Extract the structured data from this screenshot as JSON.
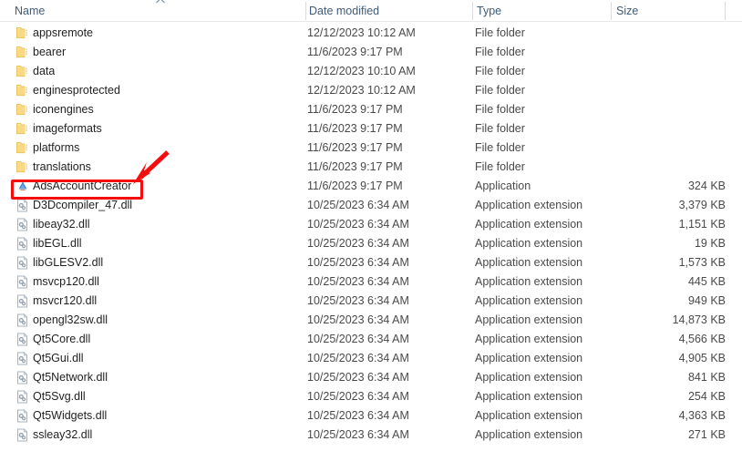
{
  "window": {
    "app": "windows-file-explorer",
    "view_mode": "details"
  },
  "columns": [
    {
      "key": "name",
      "label": "Name",
      "sorted": true,
      "sort_direction": "ascending"
    },
    {
      "key": "date",
      "label": "Date modified",
      "sorted": false,
      "sort_direction": ""
    },
    {
      "key": "type",
      "label": "Type",
      "sorted": false,
      "sort_direction": ""
    },
    {
      "key": "size",
      "label": "Size",
      "sorted": false,
      "sort_direction": ""
    }
  ],
  "colors": {
    "header_text": "#3f5b78",
    "row_text": "#1f1f1f",
    "meta_text": "#4a4a4a",
    "annotation": "#f50d0d",
    "folder_icon": "#f7d272",
    "dll_icon": "#b9c3cc"
  },
  "rows": [
    {
      "name": "appsremote",
      "date": "12/12/2023 10:12 AM",
      "type": "File folder",
      "size": "",
      "icon": "folder-icon"
    },
    {
      "name": "bearer",
      "date": "11/6/2023 9:17 PM",
      "type": "File folder",
      "size": "",
      "icon": "folder-icon"
    },
    {
      "name": "data",
      "date": "12/12/2023 10:10 AM",
      "type": "File folder",
      "size": "",
      "icon": "folder-icon"
    },
    {
      "name": "enginesprotected",
      "date": "12/12/2023 10:12 AM",
      "type": "File folder",
      "size": "",
      "icon": "folder-icon"
    },
    {
      "name": "iconengines",
      "date": "11/6/2023 9:17 PM",
      "type": "File folder",
      "size": "",
      "icon": "folder-icon"
    },
    {
      "name": "imageformats",
      "date": "11/6/2023 9:17 PM",
      "type": "File folder",
      "size": "",
      "icon": "folder-icon"
    },
    {
      "name": "platforms",
      "date": "11/6/2023 9:17 PM",
      "type": "File folder",
      "size": "",
      "icon": "folder-icon"
    },
    {
      "name": "translations",
      "date": "11/6/2023 9:17 PM",
      "type": "File folder",
      "size": "",
      "icon": "folder-icon"
    },
    {
      "name": "AdsAccountCreator",
      "date": "11/6/2023 9:17 PM",
      "type": "Application",
      "size": "324 KB",
      "icon": "application-icon",
      "highlighted": true
    },
    {
      "name": "D3Dcompiler_47.dll",
      "date": "10/25/2023 6:34 AM",
      "type": "Application extension",
      "size": "3,379 KB",
      "icon": "dll-icon"
    },
    {
      "name": "libeay32.dll",
      "date": "10/25/2023 6:34 AM",
      "type": "Application extension",
      "size": "1,151 KB",
      "icon": "dll-icon"
    },
    {
      "name": "libEGL.dll",
      "date": "10/25/2023 6:34 AM",
      "type": "Application extension",
      "size": "19 KB",
      "icon": "dll-icon"
    },
    {
      "name": "libGLESV2.dll",
      "date": "10/25/2023 6:34 AM",
      "type": "Application extension",
      "size": "1,573 KB",
      "icon": "dll-icon"
    },
    {
      "name": "msvcp120.dll",
      "date": "10/25/2023 6:34 AM",
      "type": "Application extension",
      "size": "445 KB",
      "icon": "dll-icon"
    },
    {
      "name": "msvcr120.dll",
      "date": "10/25/2023 6:34 AM",
      "type": "Application extension",
      "size": "949 KB",
      "icon": "dll-icon"
    },
    {
      "name": "opengl32sw.dll",
      "date": "10/25/2023 6:34 AM",
      "type": "Application extension",
      "size": "14,873 KB",
      "icon": "dll-icon"
    },
    {
      "name": "Qt5Core.dll",
      "date": "10/25/2023 6:34 AM",
      "type": "Application extension",
      "size": "4,566 KB",
      "icon": "dll-icon"
    },
    {
      "name": "Qt5Gui.dll",
      "date": "10/25/2023 6:34 AM",
      "type": "Application extension",
      "size": "4,905 KB",
      "icon": "dll-icon"
    },
    {
      "name": "Qt5Network.dll",
      "date": "10/25/2023 6:34 AM",
      "type": "Application extension",
      "size": "841 KB",
      "icon": "dll-icon"
    },
    {
      "name": "Qt5Svg.dll",
      "date": "10/25/2023 6:34 AM",
      "type": "Application extension",
      "size": "254 KB",
      "icon": "dll-icon"
    },
    {
      "name": "Qt5Widgets.dll",
      "date": "10/25/2023 6:34 AM",
      "type": "Application extension",
      "size": "4,363 KB",
      "icon": "dll-icon"
    },
    {
      "name": "ssleay32.dll",
      "date": "10/25/2023 6:34 AM",
      "type": "Application extension",
      "size": "271 KB",
      "icon": "dll-icon"
    }
  ],
  "annotation": {
    "shapes": [
      "highlight-rectangle",
      "pointer-arrow"
    ],
    "target_row": "AdsAccountCreator"
  }
}
